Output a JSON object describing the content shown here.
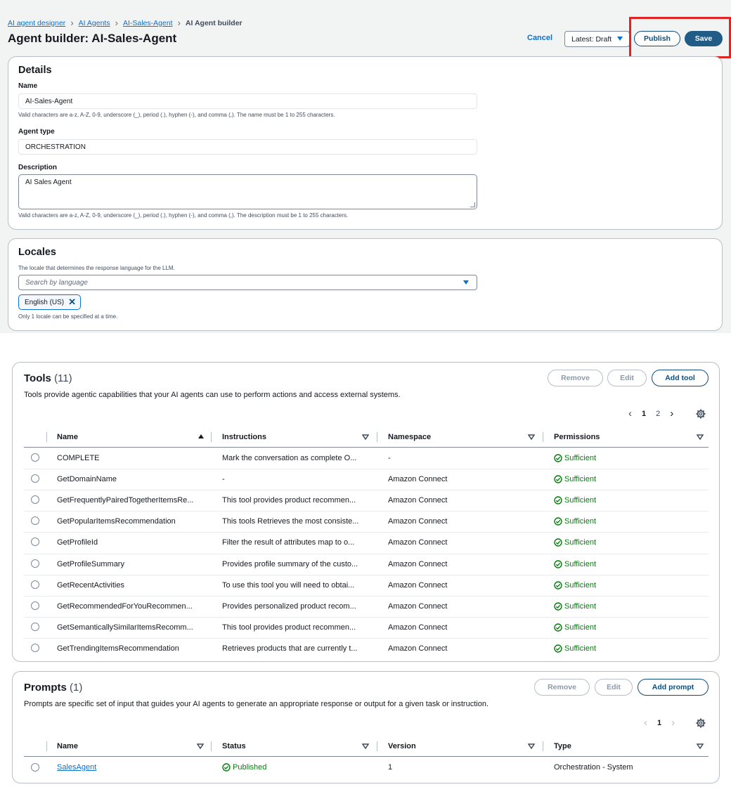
{
  "breadcrumb": {
    "items": [
      "AI agent designer",
      "AI Agents",
      "AI-Sales-Agent"
    ],
    "current": "AI Agent builder"
  },
  "page_title": "Agent builder: AI-Sales-Agent",
  "header_actions": {
    "cancel": "Cancel",
    "version": "Latest: Draft",
    "publish": "Publish",
    "save": "Save"
  },
  "details": {
    "title": "Details",
    "name_label": "Name",
    "name_value": "AI-Sales-Agent",
    "name_hint": "Valid characters are a-z, A-Z, 0-9, underscore (_), period (.), hyphen (-), and comma (,). The name must be 1 to 255 characters.",
    "type_label": "Agent type",
    "type_value": "ORCHESTRATION",
    "desc_label": "Description",
    "desc_value": "AI Sales Agent",
    "desc_hint": "Valid characters are a-z, A-Z, 0-9, underscore (_), period (.), hyphen (-), and comma (,). The description must be 1 to 255 characters."
  },
  "locales": {
    "title": "Locales",
    "hint": "The locale that determines the response language for the LLM.",
    "placeholder": "Search by language",
    "selected": "English (US)",
    "limit_note": "Only 1 locale can be specified at a time."
  },
  "tools": {
    "title": "Tools",
    "count": "(11)",
    "remove": "Remove",
    "edit": "Edit",
    "add": "Add tool",
    "description": "Tools provide agentic capabilities that your AI agents can use to perform actions and access external systems.",
    "pages": [
      "1",
      "2"
    ],
    "columns": [
      "Name",
      "Instructions",
      "Namespace",
      "Permissions"
    ],
    "rows": [
      {
        "name": "COMPLETE",
        "instructions": "Mark the conversation as complete O...",
        "namespace": "-",
        "permission": "Sufficient"
      },
      {
        "name": "GetDomainName",
        "instructions": "-",
        "namespace": "Amazon Connect",
        "permission": "Sufficient"
      },
      {
        "name": "GetFrequentlyPairedTogetherItemsRe...",
        "instructions": "This tool provides product recommen...",
        "namespace": "Amazon Connect",
        "permission": "Sufficient"
      },
      {
        "name": "GetPopularItemsRecommendation",
        "instructions": "This tools Retrieves the most consiste...",
        "namespace": "Amazon Connect",
        "permission": "Sufficient"
      },
      {
        "name": "GetProfileId",
        "instructions": "Filter the result of attributes map to o...",
        "namespace": "Amazon Connect",
        "permission": "Sufficient"
      },
      {
        "name": "GetProfileSummary",
        "instructions": "Provides profile summary of the custo...",
        "namespace": "Amazon Connect",
        "permission": "Sufficient"
      },
      {
        "name": "GetRecentActivities",
        "instructions": "To use this tool you will need to obtai...",
        "namespace": "Amazon Connect",
        "permission": "Sufficient"
      },
      {
        "name": "GetRecommendedForYouRecommen...",
        "instructions": "Provides personalized product recom...",
        "namespace": "Amazon Connect",
        "permission": "Sufficient"
      },
      {
        "name": "GetSemanticallySimilarItemsRecomm...",
        "instructions": "This tool provides product recommen...",
        "namespace": "Amazon Connect",
        "permission": "Sufficient"
      },
      {
        "name": "GetTrendingItemsRecommendation",
        "instructions": "Retrieves products that are currently t...",
        "namespace": "Amazon Connect",
        "permission": "Sufficient"
      }
    ]
  },
  "prompts": {
    "title": "Prompts",
    "count": "(1)",
    "remove": "Remove",
    "edit": "Edit",
    "add": "Add prompt",
    "description": "Prompts are specific set of input that guides your AI agents to generate an appropriate response or output for a given task or instruction.",
    "pages": [
      "1"
    ],
    "columns": [
      "Name",
      "Status",
      "Version",
      "Type"
    ],
    "rows": [
      {
        "name": "SalesAgent",
        "status": "Published",
        "version": "1",
        "type": "Orchestration - System"
      }
    ]
  },
  "colors": {
    "accent": "#0972d3",
    "primary_button": "#215c87",
    "success": "#037f0c",
    "highlight": "#e02424"
  }
}
